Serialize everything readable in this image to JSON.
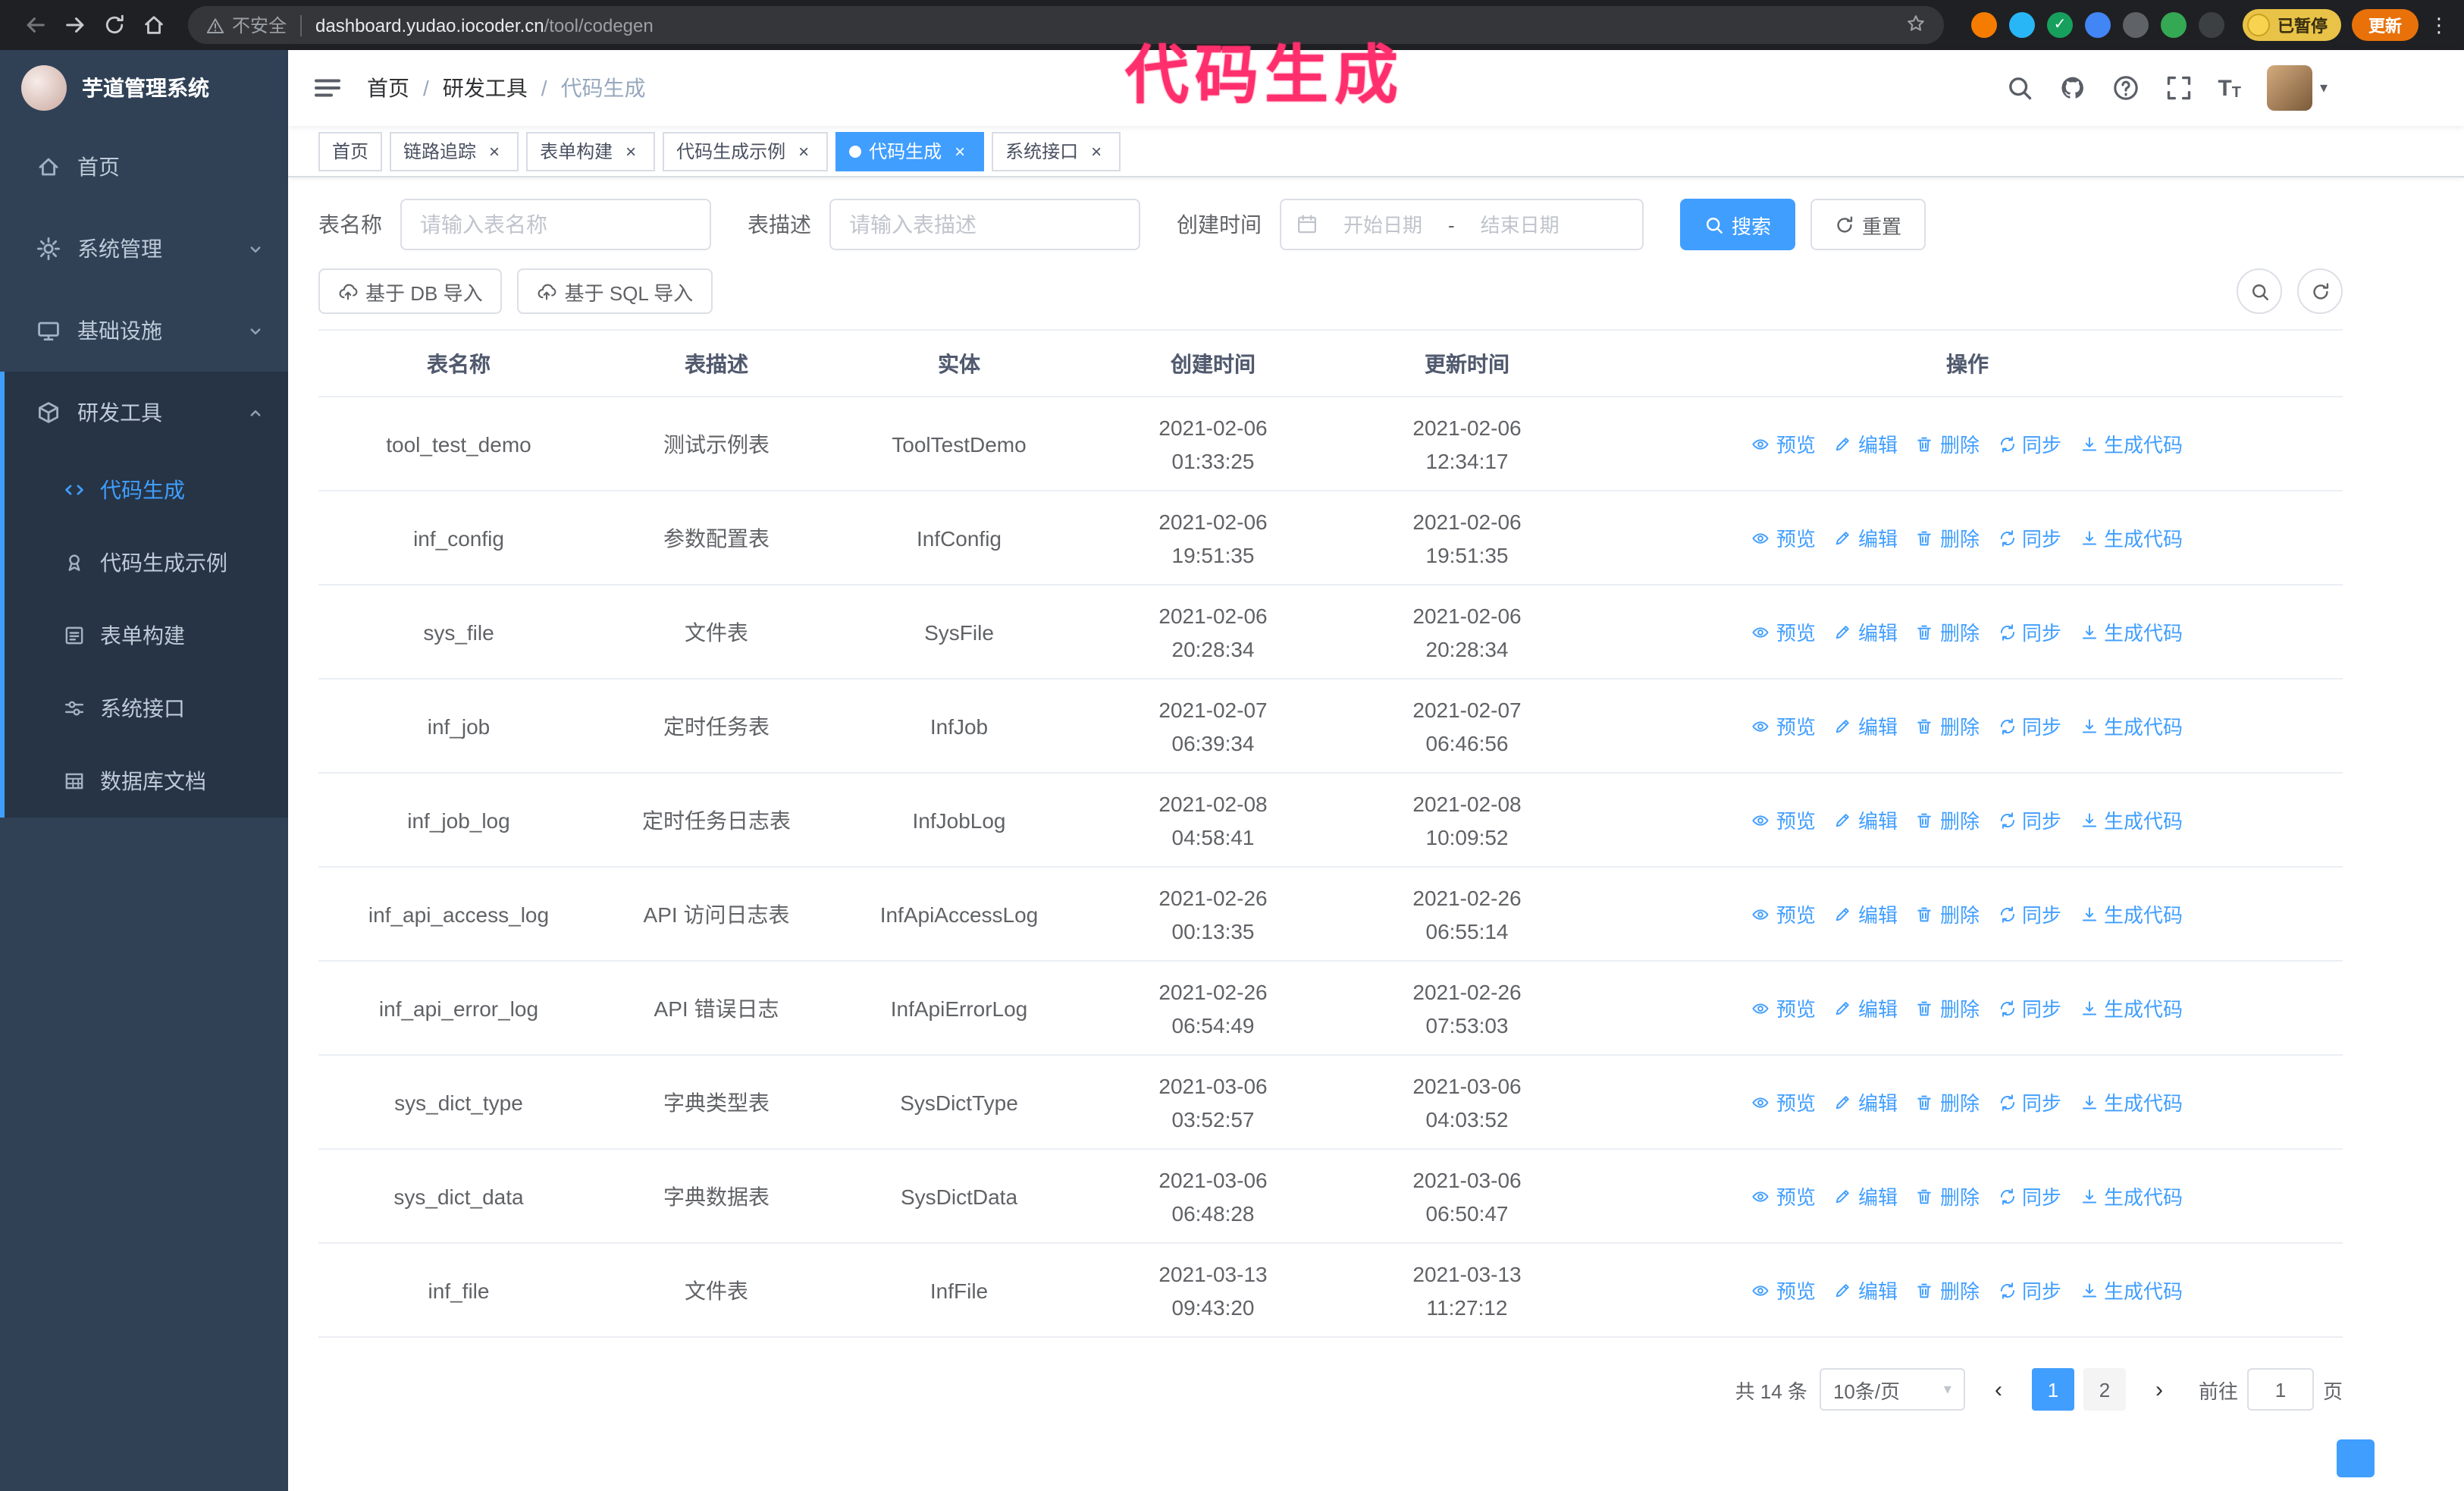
{
  "colors": {
    "accent": "#409eff",
    "sidebar_bg": "#304156",
    "submenu_bg": "#263445",
    "annotation_pink": "#ff2f6d",
    "update_pill_orange": "#e8710a",
    "paused_pill_yellow": "#e9c347"
  },
  "icons": {
    "tab_close": "×",
    "select_caret": "▾",
    "avatar_caret": "▾",
    "prev_arrow": "‹",
    "next_arrow": "›",
    "kebab_menu": "⋮",
    "extension_check": "✓"
  },
  "browser": {
    "security_label": "不安全",
    "url_domain": "dashboard.yudao.iocoder.cn",
    "url_path": "/tool/codegen",
    "profile_badge": "已暂停",
    "update_button": "更新"
  },
  "annotation": {
    "text": "代码生成"
  },
  "sidebar": {
    "logo_title": "芋道管理系统",
    "items": [
      {
        "label": "首页",
        "icon": "home-icon",
        "expandable": false,
        "expanded": false
      },
      {
        "label": "系统管理",
        "icon": "gear-icon",
        "expandable": true,
        "expanded": false
      },
      {
        "label": "基础设施",
        "icon": "monitor-icon",
        "expandable": true,
        "expanded": false
      },
      {
        "label": "研发工具",
        "icon": "tool-icon",
        "expandable": true,
        "expanded": true
      }
    ],
    "subitems": [
      {
        "label": "代码生成",
        "icon": "code-icon",
        "active": true
      },
      {
        "label": "代码生成示例",
        "icon": "badge-icon",
        "active": false
      },
      {
        "label": "表单构建",
        "icon": "form-icon",
        "active": false
      },
      {
        "label": "系统接口",
        "icon": "sliders-icon",
        "active": false
      },
      {
        "label": "数据库文档",
        "icon": "grid-icon",
        "active": false
      }
    ]
  },
  "navbar": {
    "breadcrumb": [
      "首页",
      "研发工具",
      "代码生成"
    ],
    "separator": "/"
  },
  "tabs": [
    {
      "label": "首页",
      "closable": false,
      "active": false
    },
    {
      "label": "链路追踪",
      "closable": true,
      "active": false
    },
    {
      "label": "表单构建",
      "closable": true,
      "active": false
    },
    {
      "label": "代码生成示例",
      "closable": true,
      "active": false
    },
    {
      "label": "代码生成",
      "closable": true,
      "active": true
    },
    {
      "label": "系统接口",
      "closable": true,
      "active": false
    }
  ],
  "filters": {
    "table_name_label": "表名称",
    "table_name_placeholder": "请输入表名称",
    "table_desc_label": "表描述",
    "table_desc_placeholder": "请输入表描述",
    "create_time_label": "创建时间",
    "date_start_placeholder": "开始日期",
    "date_separator": "-",
    "date_end_placeholder": "结束日期",
    "search_button": "搜索",
    "reset_button": "重置"
  },
  "toolbar": {
    "import_db_label": "基于 DB 导入",
    "import_sql_label": "基于 SQL 导入"
  },
  "table": {
    "columns": [
      "表名称",
      "表描述",
      "实体",
      "创建时间",
      "更新时间",
      "操作"
    ],
    "action_labels": [
      "预览",
      "编辑",
      "删除",
      "同步",
      "生成代码"
    ],
    "rows": [
      {
        "name": "tool_test_demo",
        "desc": "测试示例表",
        "entity": "ToolTestDemo",
        "created": "2021-02-06 01:33:25",
        "updated": "2021-02-06 12:34:17"
      },
      {
        "name": "inf_config",
        "desc": "参数配置表",
        "entity": "InfConfig",
        "created": "2021-02-06 19:51:35",
        "updated": "2021-02-06 19:51:35"
      },
      {
        "name": "sys_file",
        "desc": "文件表",
        "entity": "SysFile",
        "created": "2021-02-06 20:28:34",
        "updated": "2021-02-06 20:28:34"
      },
      {
        "name": "inf_job",
        "desc": "定时任务表",
        "entity": "InfJob",
        "created": "2021-02-07 06:39:34",
        "updated": "2021-02-07 06:46:56"
      },
      {
        "name": "inf_job_log",
        "desc": "定时任务日志表",
        "entity": "InfJobLog",
        "created": "2021-02-08 04:58:41",
        "updated": "2021-02-08 10:09:52"
      },
      {
        "name": "inf_api_access_log",
        "desc": "API 访问日志表",
        "entity": "InfApiAccessLog",
        "created": "2021-02-26 00:13:35",
        "updated": "2021-02-26 06:55:14"
      },
      {
        "name": "inf_api_error_log",
        "desc": "API 错误日志",
        "entity": "InfApiErrorLog",
        "created": "2021-02-26 06:54:49",
        "updated": "2021-02-26 07:53:03"
      },
      {
        "name": "sys_dict_type",
        "desc": "字典类型表",
        "entity": "SysDictType",
        "created": "2021-03-06 03:52:57",
        "updated": "2021-03-06 04:03:52"
      },
      {
        "name": "sys_dict_data",
        "desc": "字典数据表",
        "entity": "SysDictData",
        "created": "2021-03-06 06:48:28",
        "updated": "2021-03-06 06:50:47"
      },
      {
        "name": "inf_file",
        "desc": "文件表",
        "entity": "InfFile",
        "created": "2021-03-13 09:43:20",
        "updated": "2021-03-13 11:27:12"
      }
    ]
  },
  "pagination": {
    "total_text": "共 14 条",
    "page_size_text": "10条/页",
    "pages": [
      "1",
      "2"
    ],
    "active_page": "1",
    "goto_label": "前往",
    "goto_value": "1",
    "goto_unit": "页"
  }
}
